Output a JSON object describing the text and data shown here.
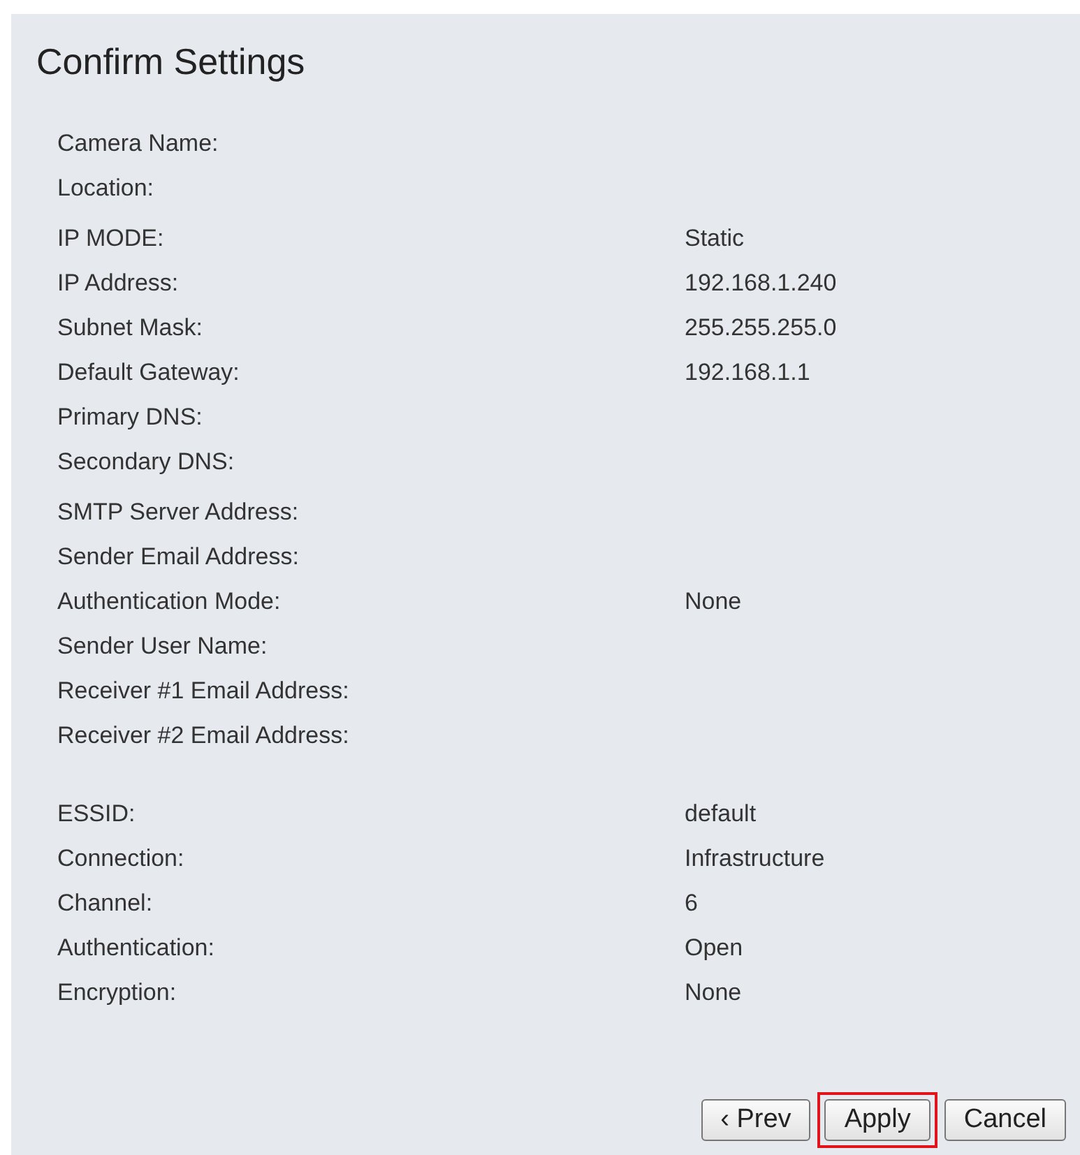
{
  "title": "Confirm Settings",
  "groups": [
    {
      "rows": [
        {
          "label": "Camera Name:"
        },
        {
          "label": "Location:"
        }
      ]
    },
    {
      "rows": [
        {
          "label": "IP MODE:",
          "value": "Static"
        },
        {
          "label": "IP Address:",
          "value": "192.168.1.240"
        },
        {
          "label": "Subnet Mask:",
          "value": "255.255.255.0"
        },
        {
          "label": "Default Gateway:",
          "value": "192.168.1.1"
        },
        {
          "label": "Primary DNS:"
        },
        {
          "label": "Secondary DNS:"
        }
      ]
    },
    {
      "rows": [
        {
          "label": "SMTP Server Address:"
        },
        {
          "label": "Sender Email Address:"
        },
        {
          "label": "Authentication Mode:",
          "value": "None"
        },
        {
          "label": "Sender User Name:"
        },
        {
          "label": "Receiver #1 Email Address:"
        },
        {
          "label": "Receiver #2 Email Address:"
        }
      ]
    },
    {
      "rows": [
        {
          "label": "ESSID:",
          "value": "default"
        },
        {
          "label": "Connection:",
          "value": "Infrastructure"
        },
        {
          "label": "Channel:",
          "value": "6"
        },
        {
          "label": "Authentication:",
          "value": "Open"
        },
        {
          "label": "Encryption:",
          "value": "None"
        }
      ]
    }
  ],
  "buttons": [
    {
      "label": "‹ Prev",
      "highlighted": false
    },
    {
      "label": "Apply",
      "highlighted": true
    },
    {
      "label": "Cancel",
      "highlighted": false
    }
  ]
}
